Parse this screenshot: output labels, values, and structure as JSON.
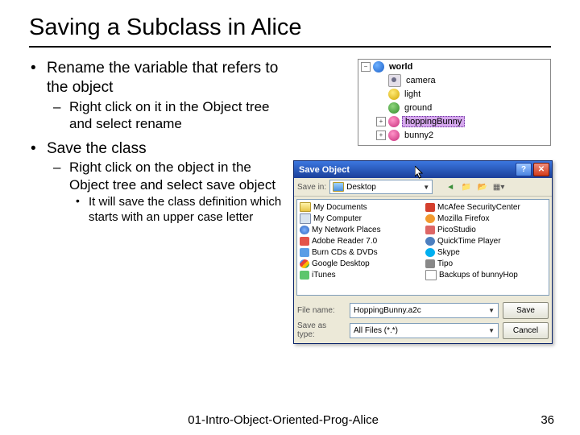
{
  "title": "Saving a Subclass in Alice",
  "bullets": {
    "b1": "Rename the variable that refers to the object",
    "b1_1": "Right click on it in the Object tree and select rename",
    "b2": "Save the class",
    "b2_1": "Right click on the object in the Object tree and select save object",
    "b2_1_1": "It will save the class definition which starts with an upper case letter"
  },
  "objtree": {
    "world": "world",
    "camera": "camera",
    "light": "light",
    "ground": "ground",
    "hoppingBunny": "hoppingBunny",
    "bunny2": "bunny2"
  },
  "dialog": {
    "title": "Save Object",
    "save_in_label": "Save in:",
    "save_in_value": "Desktop",
    "left_items": [
      "My Documents",
      "My Computer",
      "My Network Places",
      "Adobe Reader 7.0",
      "Burn CDs & DVDs",
      "Google Desktop",
      "iTunes"
    ],
    "right_items": [
      "McAfee SecurityCenter",
      "Mozilla Firefox",
      "PicoStudio",
      "QuickTime Player",
      "Skype",
      "Tipo",
      "Backups of bunnyHop"
    ],
    "file_name_label": "File name:",
    "file_name_value": "HoppingBunny.a2c",
    "save_as_type_label": "Save as type:",
    "save_as_type_value": "All Files (*.*)",
    "save_btn": "Save",
    "cancel_btn": "Cancel"
  },
  "footer": {
    "mid": "01-Intro-Object-Oriented-Prog-Alice",
    "page": "36"
  }
}
